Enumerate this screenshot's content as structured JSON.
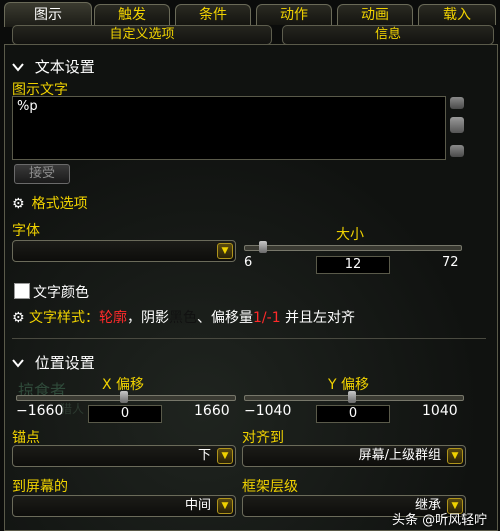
{
  "tabs": [
    "图示",
    "触发",
    "条件",
    "动作",
    "动画",
    "载入"
  ],
  "subtabs": [
    "自定义选项",
    "信息"
  ],
  "text_settings": {
    "header": "文本设置",
    "display_text_label": "图示文字",
    "display_text_value": "%p",
    "accept_button": "接受",
    "format_options": "格式选项"
  },
  "font": {
    "label": "字体",
    "value": "",
    "size_label": "大小",
    "size_min": "6",
    "size_value": "12",
    "size_max": "72",
    "size_fraction": 0.09
  },
  "text_color": {
    "label": "文字颜色",
    "checked": false
  },
  "text_style": {
    "prefix": "文字样式：",
    "outline": "轮廓",
    "mid1": "，阴影",
    "shadow_color": "黑色",
    "mid2": "、偏移量",
    "offset": "1/-1",
    "suffix": " 并且左对齐"
  },
  "position": {
    "header": "位置设置",
    "x_label": "X 偏移",
    "x_min": "−1660",
    "x_value": "0",
    "x_max": "1660",
    "y_label": "Y 偏移",
    "y_min": "−1040",
    "y_value": "0",
    "y_max": "1040",
    "anchor_label": "锚点",
    "anchor_value": "下",
    "align_label": "对齐到",
    "align_value": "屏幕/上级群组",
    "to_screen_label": "到屏幕的",
    "to_screen_value": "中间",
    "frame_level_label": "框架层级",
    "frame_level_value": "继承"
  },
  "background_text": [
    "掠食者",
    "猎人"
  ],
  "watermark": "头条 @听风轻咛",
  "colors": {
    "gold": "#f0d200",
    "red": "#ff2a2a",
    "panel_border": "#5a5a4a"
  }
}
